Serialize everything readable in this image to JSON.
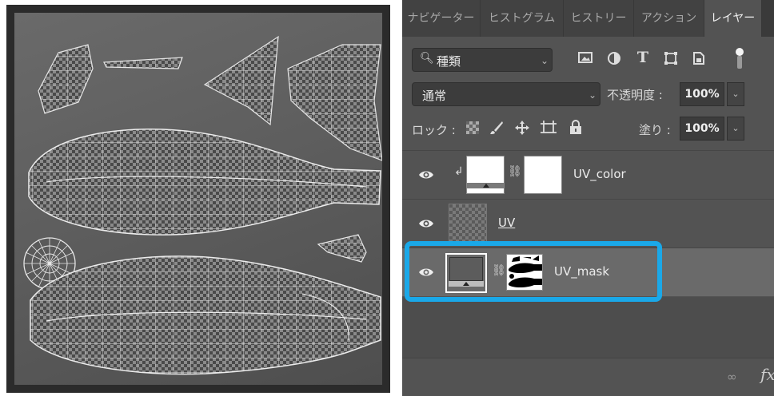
{
  "tabs": [
    {
      "label": "ナビゲーター",
      "active": false
    },
    {
      "label": "ヒストグラム",
      "active": false
    },
    {
      "label": "ヒストリー",
      "active": false
    },
    {
      "label": "アクション",
      "active": false
    },
    {
      "label": "レイヤー",
      "active": true
    }
  ],
  "filter": {
    "search_label": "種類",
    "search_icon": "search-icon",
    "icons": [
      "image-filter-icon",
      "adjustment-filter-icon",
      "type-filter-icon",
      "shape-filter-icon",
      "smart-object-filter-icon",
      "filter-toggle-icon"
    ]
  },
  "blend": {
    "mode": "通常",
    "opacity_label": "不透明度 :",
    "opacity_value": "100%"
  },
  "lock": {
    "label": "ロック :",
    "fill_label": "塗り :",
    "fill_value": "100%",
    "icons": [
      "lock-transparent-icon",
      "lock-paint-icon",
      "lock-position-icon",
      "lock-artboard-icon",
      "lock-all-icon"
    ]
  },
  "layers": [
    {
      "name": "UV_color",
      "visible": true,
      "clipped": true,
      "type": "fill-with-mask"
    },
    {
      "name": "UV",
      "visible": true,
      "clipped": false,
      "type": "transparent-pixel"
    },
    {
      "name": "UV_mask",
      "visible": true,
      "clipped": false,
      "type": "fill-with-mask",
      "selected": true
    }
  ],
  "bottom": {
    "icons": [
      "link-layers-icon",
      "fx-icon"
    ],
    "fx_label": "fx"
  },
  "colors": {
    "highlight": "#1aa8e8",
    "panel_bg": "#535353",
    "canvas_bg": "#5e5e5e"
  }
}
